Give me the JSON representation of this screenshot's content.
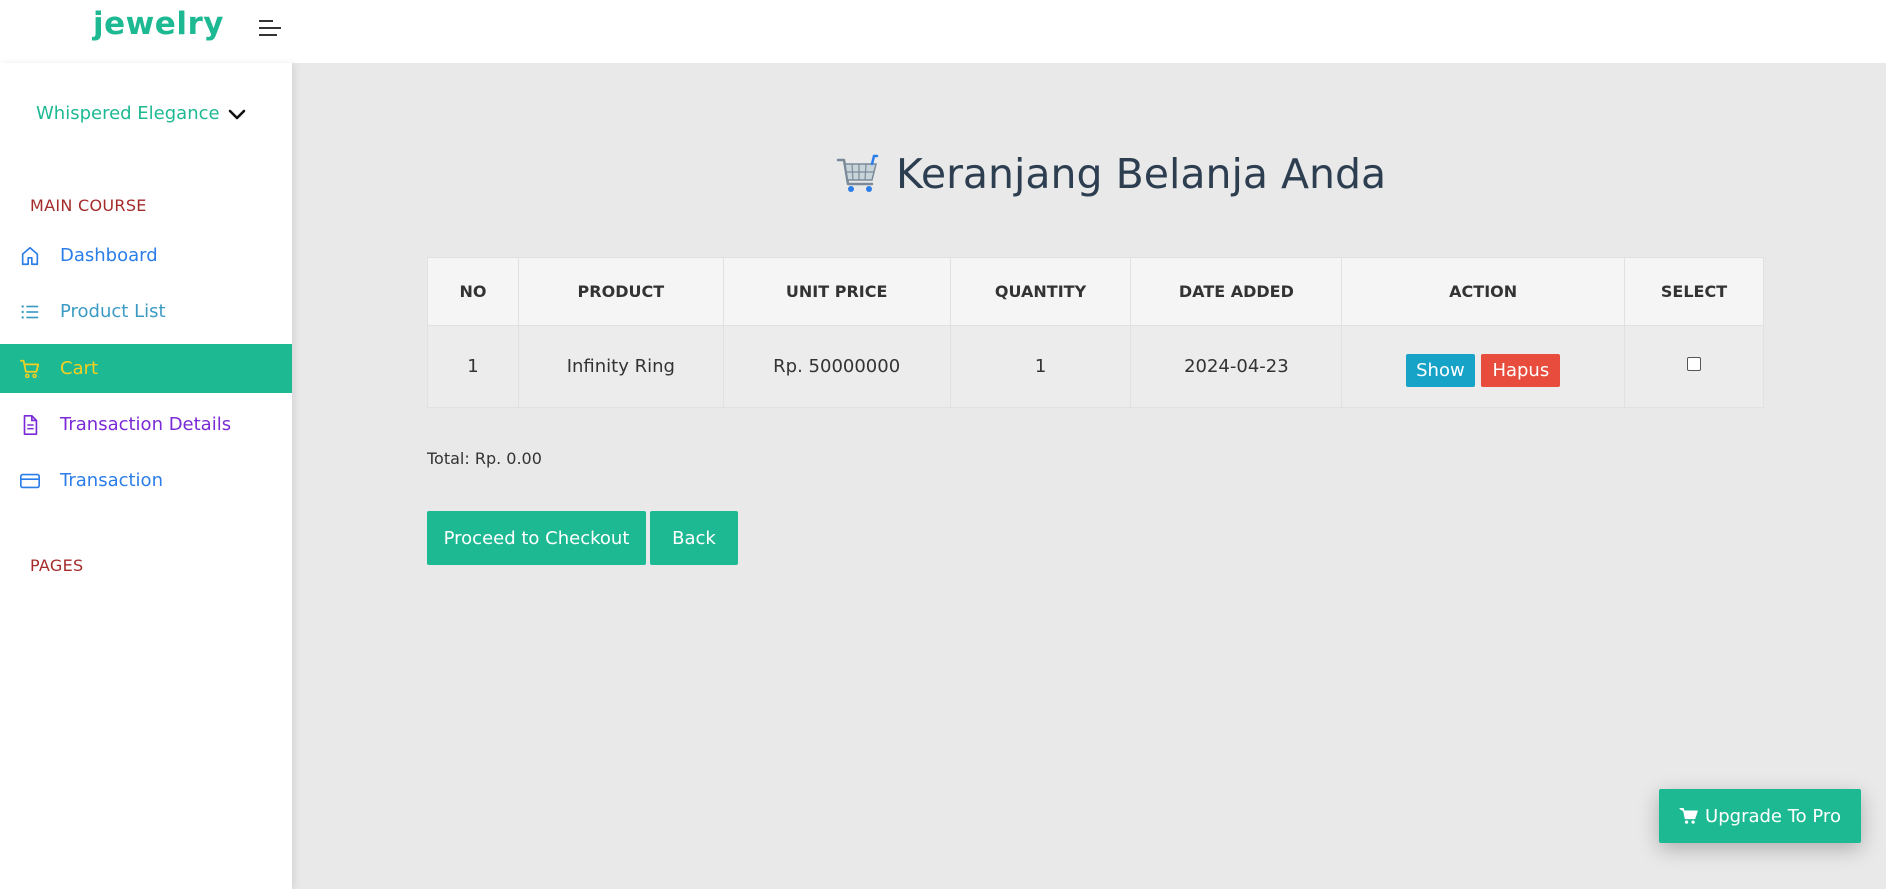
{
  "header": {
    "brand": "jewelry"
  },
  "sidebar": {
    "profile_name": "Whispered Elegance",
    "section_main": "MAIN COURSE",
    "section_pages": "PAGES",
    "items": [
      {
        "label": "Dashboard",
        "icon": "home-icon",
        "color": "#2b7de9"
      },
      {
        "label": "Product List",
        "icon": "list-icon",
        "color": "#3b9bc4"
      },
      {
        "label": "Cart",
        "icon": "cart-icon",
        "color": "#f5d020",
        "active": true
      },
      {
        "label": "Transaction Details",
        "icon": "document-icon",
        "color": "#7a2ad6"
      },
      {
        "label": "Transaction",
        "icon": "credit-card-icon",
        "color": "#2b7de9"
      }
    ]
  },
  "main": {
    "title": "Keranjang Belanja Anda",
    "table": {
      "columns": [
        "NO",
        "PRODUCT",
        "UNIT PRICE",
        "QUANTITY",
        "DATE ADDED",
        "ACTION",
        "SELECT"
      ],
      "rows": [
        {
          "no": "1",
          "product": "Infinity Ring",
          "unit_price": "Rp. 50000000",
          "quantity": "1",
          "date_added": "2024-04-23",
          "show_label": "Show",
          "delete_label": "Hapus"
        }
      ]
    },
    "total": "Total: Rp. 0.00",
    "checkout_label": "Proceed to Checkout",
    "back_label": "Back",
    "upgrade_label": "Upgrade To Pro"
  },
  "colors": {
    "accent": "#1db993",
    "show_button": "#17a2c8",
    "delete_button": "#e74c3c",
    "section_label": "#a52a2a"
  }
}
